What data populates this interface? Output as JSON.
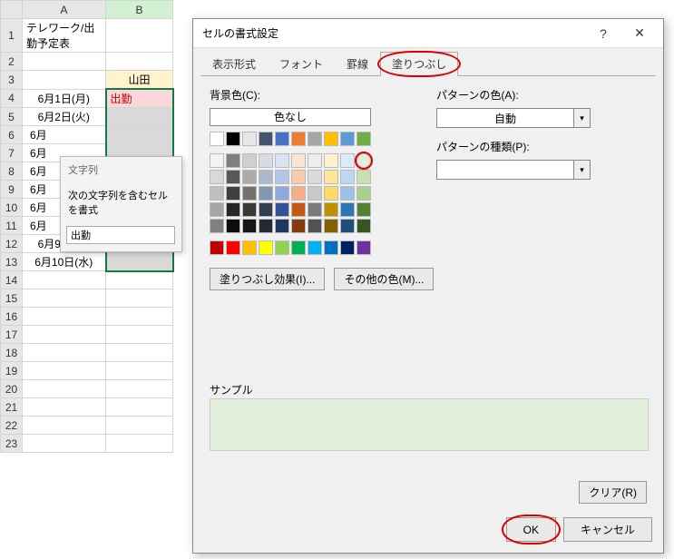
{
  "sheet": {
    "title": "テレワーク/出勤予定表",
    "colA": "A",
    "colB": "B",
    "headerB": "山田",
    "rows": [
      {
        "n": "1",
        "a": "テレワーク/出勤予定表",
        "b": ""
      },
      {
        "n": "2",
        "a": "",
        "b": ""
      },
      {
        "n": "3",
        "a": "",
        "b": "山田"
      },
      {
        "n": "4",
        "a": "6月1日(月)",
        "b": "出勤"
      },
      {
        "n": "5",
        "a": "6月2日(火)",
        "b": ""
      },
      {
        "n": "6",
        "a": "6月",
        "b": ""
      },
      {
        "n": "7",
        "a": "6月",
        "b": ""
      },
      {
        "n": "8",
        "a": "6月",
        "b": ""
      },
      {
        "n": "9",
        "a": "6月",
        "b": ""
      },
      {
        "n": "10",
        "a": "6月",
        "b": ""
      },
      {
        "n": "11",
        "a": "6月",
        "b": ""
      },
      {
        "n": "12",
        "a": "6月9日(火)",
        "b": ""
      },
      {
        "n": "13",
        "a": "6月10日(水)",
        "b": ""
      },
      {
        "n": "14",
        "a": "",
        "b": ""
      },
      {
        "n": "15",
        "a": "",
        "b": ""
      },
      {
        "n": "16",
        "a": "",
        "b": ""
      },
      {
        "n": "17",
        "a": "",
        "b": ""
      },
      {
        "n": "18",
        "a": "",
        "b": ""
      },
      {
        "n": "19",
        "a": "",
        "b": ""
      },
      {
        "n": "20",
        "a": "",
        "b": ""
      },
      {
        "n": "21",
        "a": "",
        "b": ""
      },
      {
        "n": "22",
        "a": "",
        "b": ""
      },
      {
        "n": "23",
        "a": "",
        "b": ""
      }
    ]
  },
  "popup": {
    "title": "文字列",
    "line": "次の文字列を含むセルを書式",
    "value": "出勤"
  },
  "dialog": {
    "title": "セルの書式設定",
    "help": "?",
    "close": "✕",
    "tabs": {
      "format": "表示形式",
      "font": "フォント",
      "border": "罫線",
      "fill": "塗りつぶし"
    },
    "bgcolor_label": "背景色(C):",
    "nocolor": "色なし",
    "fill_effects": "塗りつぶし効果(I)...",
    "more_colors": "その他の色(M)...",
    "pattern_color_label": "パターンの色(A):",
    "pattern_color_value": "自動",
    "pattern_type_label": "パターンの種類(P):",
    "sample_label": "サンプル",
    "clear": "クリア(R)",
    "ok": "OK",
    "cancel": "キャンセル",
    "theme_row0": [
      "#ffffff",
      "#000000",
      "#e7e6e6",
      "#44546a",
      "#4472c4",
      "#ed7d31",
      "#a5a5a5",
      "#ffc000",
      "#5b9bd5",
      "#70ad47"
    ],
    "theme_grid": [
      [
        "#f2f2f2",
        "#7f7f7f",
        "#d0cece",
        "#d6dce4",
        "#d9e1f2",
        "#fce4d6",
        "#ededed",
        "#fff2cc",
        "#ddebf7",
        "#e2efda"
      ],
      [
        "#d9d9d9",
        "#595959",
        "#aeaaaa",
        "#acb9ca",
        "#b4c6e7",
        "#f8cbad",
        "#dbdbdb",
        "#ffe699",
        "#bdd7ee",
        "#c6e0b4"
      ],
      [
        "#bfbfbf",
        "#404040",
        "#757171",
        "#8497b0",
        "#8ea9db",
        "#f4b084",
        "#c9c9c9",
        "#ffd966",
        "#9bc2e6",
        "#a9d08e"
      ],
      [
        "#a6a6a6",
        "#262626",
        "#3a3838",
        "#333f4f",
        "#305496",
        "#c65911",
        "#7b7b7b",
        "#bf8f00",
        "#2f75b5",
        "#548235"
      ],
      [
        "#808080",
        "#0d0d0d",
        "#161616",
        "#222b35",
        "#203764",
        "#833c0c",
        "#525252",
        "#806000",
        "#1f4e78",
        "#375623"
      ]
    ],
    "standard": [
      "#c00000",
      "#ff0000",
      "#ffc000",
      "#ffff00",
      "#92d050",
      "#00b050",
      "#00b0f0",
      "#0070c0",
      "#002060",
      "#7030a0"
    ],
    "selected_swatch": "0,9"
  }
}
